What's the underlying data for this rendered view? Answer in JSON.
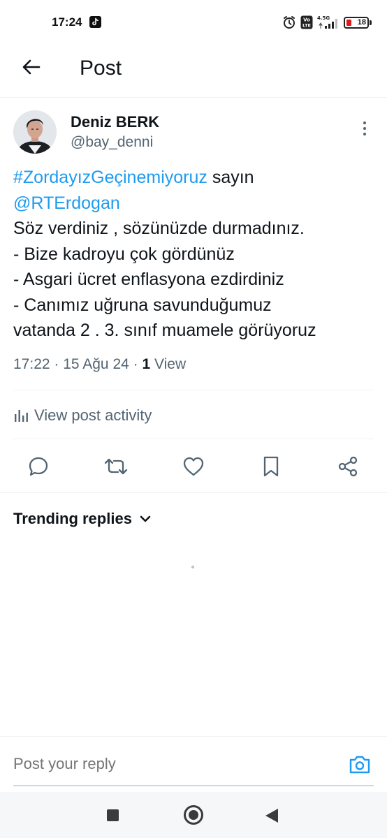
{
  "status_bar": {
    "time": "17:24",
    "network": "4.5G",
    "battery": 18,
    "battery_color": "#e0191c"
  },
  "header": {
    "title": "Post",
    "back_icon": "arrow-left-icon"
  },
  "post": {
    "author_name": "Deniz BERK",
    "author_handle": "@bay_denni",
    "text": {
      "hashtag": "#ZordayızGeçinemiyoruz",
      "after_hashtag": " sayın",
      "mention": "@RTErdogan",
      "lines": [
        "Söz verdiniz , sözünüzde durmadınız.",
        "- Bize kadroyu çok gördünüz",
        "- Asgari ücret enflasyona ezdirdiniz",
        "- Canımız uğruna savunduğumuz",
        "vatanda 2 . 3. sınıf muamele görüyoruz"
      ]
    },
    "meta": {
      "time_date": "17:22 · 15 Ağu 24 · ",
      "views_count": "1",
      "views_label": " View"
    },
    "activity_label": "View post activity",
    "actions": [
      "reply-icon",
      "retweet-icon",
      "like-icon",
      "bookmark-icon",
      "share-icon"
    ]
  },
  "replies": {
    "sort_label": "Trending replies"
  },
  "reply_bar": {
    "placeholder": "Post your reply"
  },
  "colors": {
    "link": "#1d9bf0",
    "secondary_text": "#536471",
    "primary_text": "#0f1419"
  }
}
